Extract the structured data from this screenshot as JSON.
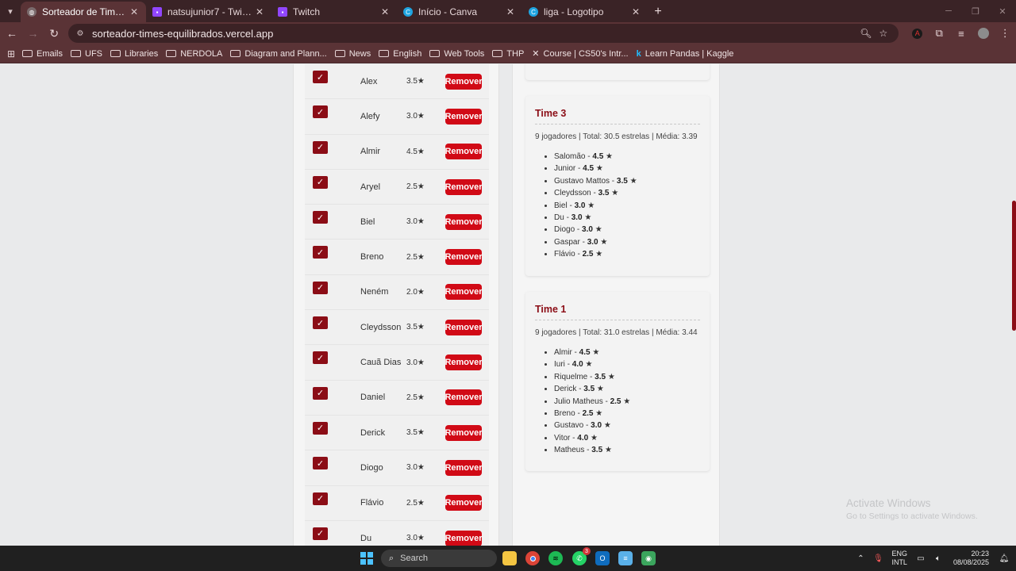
{
  "browser": {
    "tabs": [
      {
        "title": "Sorteador de Times Equilibrados",
        "icon": "globe-icon",
        "active": true
      },
      {
        "title": "natsujunior7 - Twitch",
        "icon": "twitch-icon",
        "active": false
      },
      {
        "title": "Twitch",
        "icon": "twitch-icon",
        "active": false
      },
      {
        "title": "Início - Canva",
        "icon": "canva-icon",
        "active": false
      },
      {
        "title": "liga - Logotipo",
        "icon": "canva-icon",
        "active": false
      }
    ],
    "url": "sorteador-times-equilibrados.vercel.app",
    "bookmarks": [
      {
        "label": "Emails",
        "icon": "folder-icon"
      },
      {
        "label": "UFS",
        "icon": "folder-icon"
      },
      {
        "label": "Libraries",
        "icon": "folder-icon"
      },
      {
        "label": "NERDOLA",
        "icon": "folder-icon"
      },
      {
        "label": "Diagram and Plann...",
        "icon": "folder-icon"
      },
      {
        "label": "News",
        "icon": "folder-icon"
      },
      {
        "label": "English",
        "icon": "folder-icon"
      },
      {
        "label": "Web Tools",
        "icon": "folder-icon"
      },
      {
        "label": "THP",
        "icon": "folder-icon"
      },
      {
        "label": "Course | CS50's Intr...",
        "icon": "cs50-icon"
      },
      {
        "label": "Learn Pandas | Kaggle",
        "icon": "kaggle-icon"
      }
    ],
    "colors": {
      "frame": "#3a2326",
      "toolbar": "#5a3336",
      "accent": "#8b0d16",
      "remove_button": "#d10a16"
    }
  },
  "players": {
    "remove_label": "Remover",
    "check_mark": "✓",
    "items": [
      {
        "name": "Alex",
        "rating": "3.5★"
      },
      {
        "name": "Alefy",
        "rating": "3.0★"
      },
      {
        "name": "Almir",
        "rating": "4.5★"
      },
      {
        "name": "Aryel",
        "rating": "2.5★"
      },
      {
        "name": "Biel",
        "rating": "3.0★"
      },
      {
        "name": "Breno",
        "rating": "2.5★"
      },
      {
        "name": "Neném",
        "rating": "2.0★"
      },
      {
        "name": "Cleydsson",
        "rating": "3.5★"
      },
      {
        "name": "Cauã Dias",
        "rating": "3.0★"
      },
      {
        "name": "Daniel",
        "rating": "2.5★"
      },
      {
        "name": "Derick",
        "rating": "3.5★"
      },
      {
        "name": "Diogo",
        "rating": "3.0★"
      },
      {
        "name": "Flávio",
        "rating": "2.5★"
      },
      {
        "name": "Du",
        "rating": "3.0★"
      }
    ]
  },
  "teams": [
    {
      "title": "Time 3",
      "summary": "9 jogadores | Total: 30.5 estrelas | Média: 3.39",
      "players": [
        {
          "name": "Salomão",
          "rating": "4.5"
        },
        {
          "name": "Junior",
          "rating": "4.5"
        },
        {
          "name": "Gustavo Mattos",
          "rating": "3.5"
        },
        {
          "name": "Cleydsson",
          "rating": "3.5"
        },
        {
          "name": "Biel",
          "rating": "3.0"
        },
        {
          "name": "Du",
          "rating": "3.0"
        },
        {
          "name": "Diogo",
          "rating": "3.0"
        },
        {
          "name": "Gaspar",
          "rating": "3.0"
        },
        {
          "name": "Flávio",
          "rating": "2.5"
        }
      ]
    },
    {
      "title": "Time 1",
      "summary": "9 jogadores | Total: 31.0 estrelas | Média: 3.44",
      "players": [
        {
          "name": "Almir",
          "rating": "4.5"
        },
        {
          "name": "Iuri",
          "rating": "4.0"
        },
        {
          "name": "Riquelme",
          "rating": "3.5"
        },
        {
          "name": "Derick",
          "rating": "3.5"
        },
        {
          "name": "Julio Matheus",
          "rating": "2.5"
        },
        {
          "name": "Breno",
          "rating": "2.5"
        },
        {
          "name": "Gustavo",
          "rating": "3.0"
        },
        {
          "name": "Vitor",
          "rating": "4.0"
        },
        {
          "name": "Matheus",
          "rating": "3.5"
        }
      ]
    }
  ],
  "watermark": {
    "line1": "Activate Windows",
    "line2": "Go to Settings to activate Windows."
  },
  "taskbar": {
    "search_placeholder": "Search",
    "whatsapp_badge": "3",
    "lang_top": "ENG",
    "lang_bottom": "INTL",
    "time": "20:23",
    "date": "08/08/2025"
  }
}
